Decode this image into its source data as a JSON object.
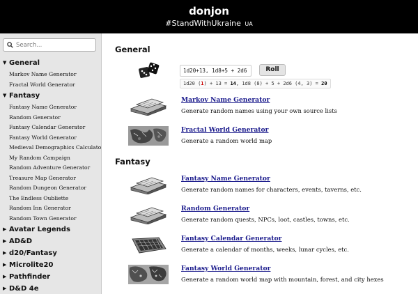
{
  "site": {
    "title": "donjon",
    "tagline": "#StandWithUkraine",
    "tagline_suffix": "UA"
  },
  "search": {
    "placeholder": "Search..."
  },
  "nav": {
    "groups": [
      {
        "label": "General",
        "expanded": true,
        "items": [
          "Markov Name Generator",
          "Fractal World Generator"
        ]
      },
      {
        "label": "Fantasy",
        "expanded": true,
        "items": [
          "Fantasy Name Generator",
          "Random Generator",
          "Fantasy Calendar Generator",
          "Fantasy World Generator",
          "Medieval Demographics Calculator",
          "My Random Campaign",
          "Random Adventure Generator",
          "Treasure Map Generator",
          "Random Dungeon Generator",
          "The Endless Oubliette",
          "Random Inn Generator",
          "Random Town Generator"
        ]
      },
      {
        "label": "Avatar Legends",
        "expanded": false
      },
      {
        "label": "AD&D",
        "expanded": false
      },
      {
        "label": "d20/Fantasy",
        "expanded": false
      },
      {
        "label": "Microlite20",
        "expanded": false
      },
      {
        "label": "Pathfinder",
        "expanded": false
      },
      {
        "label": "D&D 4e",
        "expanded": false
      }
    ]
  },
  "main": {
    "sections": [
      {
        "title": "General"
      },
      {
        "title": "Fantasy"
      }
    ],
    "dice": {
      "input_value": "1d20+13, 1d8+5 + 2d6",
      "roll_label": "Roll",
      "result": {
        "part1": "1d20 (",
        "red_value": "1",
        "part2": ") + 13 = ",
        "total1": "14",
        "part3": ", 1d8 (8) + 5 + 2d6 (4, 3) = ",
        "total2": "20"
      }
    },
    "general_entries": [
      {
        "title": "Markov Name Generator",
        "desc": "Generate random names using your own source lists"
      },
      {
        "title": "Fractal World Generator",
        "desc": "Generate a random world map"
      }
    ],
    "fantasy_entries": [
      {
        "title": "Fantasy Name Generator",
        "desc": "Generate random names for characters, events, taverns, etc."
      },
      {
        "title": "Random Generator",
        "desc": "Generate random quests, NPCs, loot, castles, towns, etc."
      },
      {
        "title": "Fantasy Calendar Generator",
        "desc": "Generate a calendar of months, weeks, lunar cycles, etc."
      },
      {
        "title": "Fantasy World Generator",
        "desc": "Generate a random world map with mountain, forest, and city hexes"
      }
    ]
  }
}
